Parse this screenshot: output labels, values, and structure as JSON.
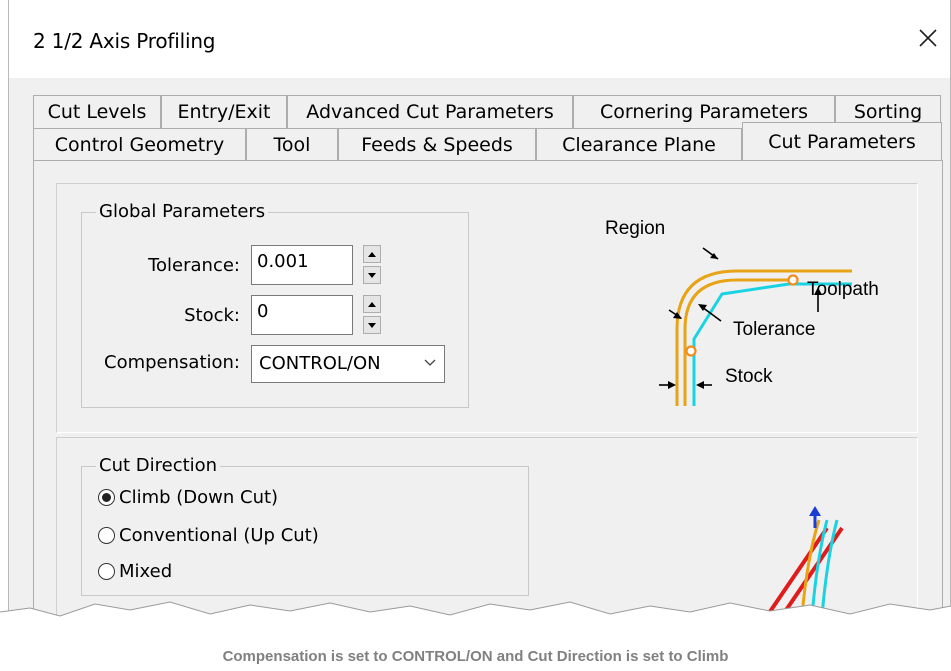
{
  "window": {
    "title": "2 1/2 Axis Profiling",
    "close_icon": "close-icon"
  },
  "tabs": {
    "row_back": [
      "Cut Levels",
      "Entry/Exit",
      "Advanced Cut Parameters",
      "Cornering Parameters",
      "Sorting"
    ],
    "row_front": [
      "Control Geometry",
      "Tool",
      "Feeds & Speeds",
      "Clearance Plane",
      "Cut Parameters"
    ],
    "active": "Cut Parameters"
  },
  "global_parameters": {
    "title": "Global Parameters",
    "tolerance_label": "Tolerance:",
    "tolerance_value": "0.001",
    "stock_label": "Stock:",
    "stock_value": "0",
    "compensation_label": "Compensation:",
    "compensation_value": "CONTROL/ON"
  },
  "diagram": {
    "region": "Region",
    "toolpath": "Toolpath",
    "tolerance": "Tolerance",
    "stock": "Stock",
    "colors": {
      "region": "#e8a317",
      "toolpath": "#19d3e3",
      "marker": "#f28c1e"
    }
  },
  "cut_direction": {
    "title": "Cut Direction",
    "options": [
      "Climb (Down Cut)",
      "Conventional (Up Cut)",
      "Mixed"
    ],
    "selected": "Climb (Down Cut)"
  },
  "caption": "Compensation is set to CONTROL/ON and Cut Direction is set to Climb"
}
